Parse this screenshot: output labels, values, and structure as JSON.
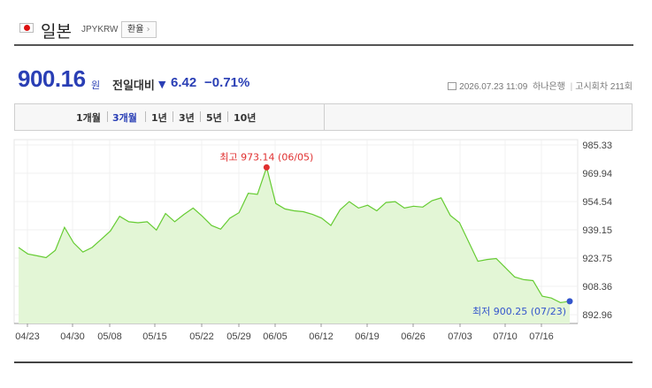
{
  "header": {
    "country": "일본",
    "code": "JPYKRW",
    "rate_button": "환율",
    "flag_icon": "japan-flag-icon"
  },
  "price": {
    "value": "900.16",
    "unit": "원",
    "compare_label": "전일대비",
    "direction_symbol": "▼",
    "change": "6.42",
    "percent": "−0.71%"
  },
  "meta": {
    "datetime": "2026.07.23 11:09",
    "bank": "하나은행",
    "notice": "고시회차 211회"
  },
  "tabs": [
    {
      "label": "1개월",
      "active": false
    },
    {
      "label": "3개월",
      "active": true
    },
    {
      "label": "1년",
      "active": false
    },
    {
      "label": "3년",
      "active": false
    },
    {
      "label": "5년",
      "active": false
    },
    {
      "label": "10년",
      "active": false
    }
  ],
  "chart_data": {
    "type": "area",
    "x_ticks": [
      "04/23",
      "04/30",
      "05/08",
      "05/15",
      "05/22",
      "05/29",
      "06/05",
      "06/12",
      "06/19",
      "06/26",
      "07/03",
      "07/10",
      "07/16"
    ],
    "y_ticks": [
      985.33,
      969.94,
      954.54,
      939.15,
      923.75,
      908.36,
      892.96
    ],
    "ylim": [
      892.96,
      985.33
    ],
    "values": [
      929.5,
      926.0,
      925.0,
      924.0,
      928.0,
      940.5,
      932.0,
      927.0,
      929.5,
      934.0,
      938.5,
      946.5,
      943.5,
      943.0,
      943.5,
      939.0,
      948.0,
      943.5,
      947.5,
      951.0,
      946.5,
      941.5,
      939.5,
      945.5,
      948.5,
      959.0,
      958.5,
      973.14,
      953.5,
      950.5,
      949.5,
      949.0,
      947.5,
      945.5,
      941.5,
      950.0,
      954.5,
      951.0,
      952.5,
      949.5,
      954.0,
      954.5,
      951.0,
      952.0,
      951.5,
      955.0,
      956.5,
      947.0,
      943.0,
      932.5,
      922.0,
      923.0,
      923.5,
      918.5,
      913.5,
      912.0,
      911.5,
      903.0,
      902.0,
      899.5,
      900.25
    ],
    "max_label": "최고 973.14 (06/05)",
    "min_label": "최저 900.25 (07/23)",
    "max_index": 27,
    "line_color": "#66cc33",
    "fill_color": "#e3f6d6",
    "max_color": "#e03030",
    "min_color": "#3355cc"
  }
}
